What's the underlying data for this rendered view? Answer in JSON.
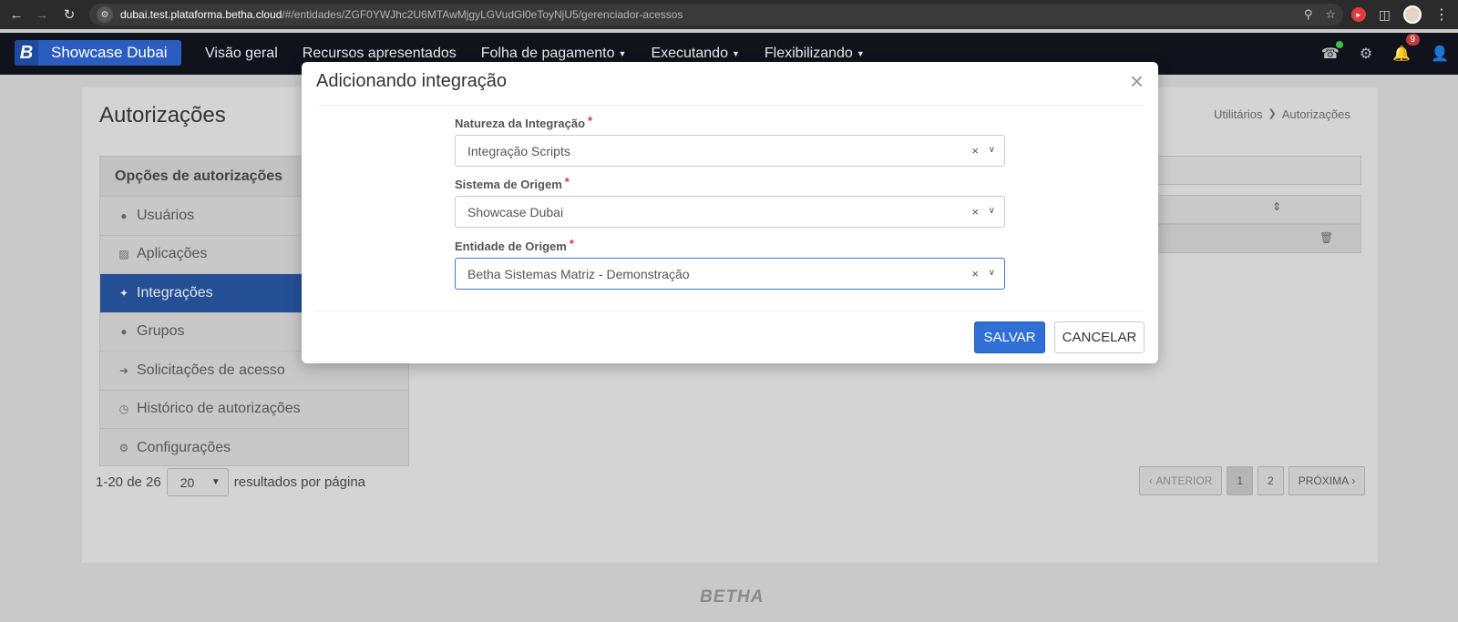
{
  "browser": {
    "url_domain": "dubai.test.plataforma.betha.cloud",
    "url_path": "/#/entidades/ZGF0YWJhc2U6MTAwMjgyLGVudGl0eToyNjU5/gerenciador-acessos"
  },
  "app_nav": {
    "brand_logo": "B",
    "brand_name": "Showcase Dubai",
    "menu": [
      {
        "label": "Visão geral"
      },
      {
        "label": "Recursos apresentados"
      },
      {
        "label": "Folha de pagamento"
      },
      {
        "label": "Executando"
      },
      {
        "label": "Flexibilizando"
      }
    ],
    "notification_count": "9"
  },
  "page": {
    "title": "Autorizações",
    "breadcrumb": [
      "Utilitários",
      "Autorizações"
    ]
  },
  "sidebar": {
    "header": "Opções de autorizações",
    "items": [
      {
        "label": "Usuários",
        "icon": "user-icon"
      },
      {
        "label": "Aplicações",
        "icon": "sitemap-icon"
      },
      {
        "label": "Integrações",
        "icon": "puzzle-icon"
      },
      {
        "label": "Grupos",
        "icon": "users-icon"
      },
      {
        "label": "Solicitações de acesso",
        "icon": "sign-in-icon"
      },
      {
        "label": "Histórico de autorizações",
        "icon": "history-icon"
      },
      {
        "label": "Configurações",
        "icon": "cogs-icon"
      }
    ],
    "active_index": 2
  },
  "pagination": {
    "range_text": "1-20 de 26",
    "per_page": "20",
    "per_page_suffix": "resultados por página",
    "prev": "ANTERIOR",
    "pages": [
      "1",
      "2"
    ],
    "current_page": "1",
    "next": "PRÓXIMA"
  },
  "footer": {
    "logo": "BETHA"
  },
  "modal": {
    "title": "Adicionando integração",
    "fields": [
      {
        "label": "Natureza da Integração",
        "value": "Integração Scripts"
      },
      {
        "label": "Sistema de Origem",
        "value": "Showcase Dubai"
      },
      {
        "label": "Entidade de Origem",
        "value": "Betha Sistemas Matriz - Demonstração"
      }
    ],
    "save_label": "SALVAR",
    "cancel_label": "CANCELAR"
  },
  "colors": {
    "primary": "#2f6fd6",
    "navbar": "#10131c",
    "active_sidebar": "#254f95",
    "required": "#d33333"
  }
}
